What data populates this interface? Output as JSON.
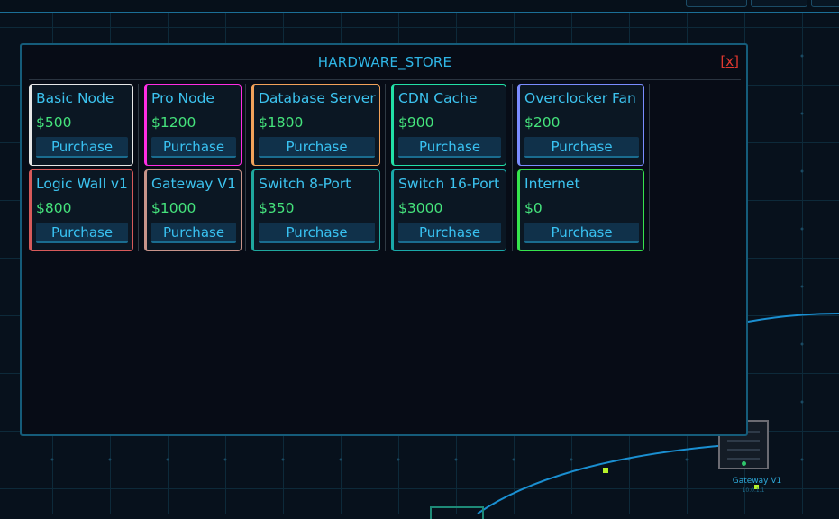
{
  "store": {
    "title": "HARDWARE_STORE",
    "close_label": "[x]",
    "items": [
      {
        "name": "Basic Node",
        "price": "$500",
        "action": "Purchase",
        "accent": "#e7e7e7"
      },
      {
        "name": "Pro Node",
        "price": "$1200",
        "action": "Purchase",
        "accent": "#ff2de3"
      },
      {
        "name": "Database Server",
        "price": "$1800",
        "action": "Purchase",
        "accent": "#f2a25a"
      },
      {
        "name": "CDN Cache",
        "price": "$900",
        "action": "Purchase",
        "accent": "#22e0a6"
      },
      {
        "name": "Overclocker Fan",
        "price": "$200",
        "action": "Purchase",
        "accent": "#7a8cff"
      },
      {
        "name": "Logic Wall v1",
        "price": "$800",
        "action": "Purchase",
        "accent": "#d75a5a"
      },
      {
        "name": "Gateway V1",
        "price": "$1000",
        "action": "Purchase",
        "accent": "#c8948a"
      },
      {
        "name": "Switch 8-Port",
        "price": "$350",
        "action": "Purchase",
        "accent": "#1fa89e"
      },
      {
        "name": "Switch 16-Port",
        "price": "$3000",
        "action": "Purchase",
        "accent": "#1aa9a9"
      },
      {
        "name": "Internet",
        "price": "$0",
        "action": "Purchase",
        "accent": "#36e34d"
      }
    ]
  },
  "network": {
    "gateway_label": "Gateway V1",
    "gateway_ip": "10.0.1.1"
  }
}
